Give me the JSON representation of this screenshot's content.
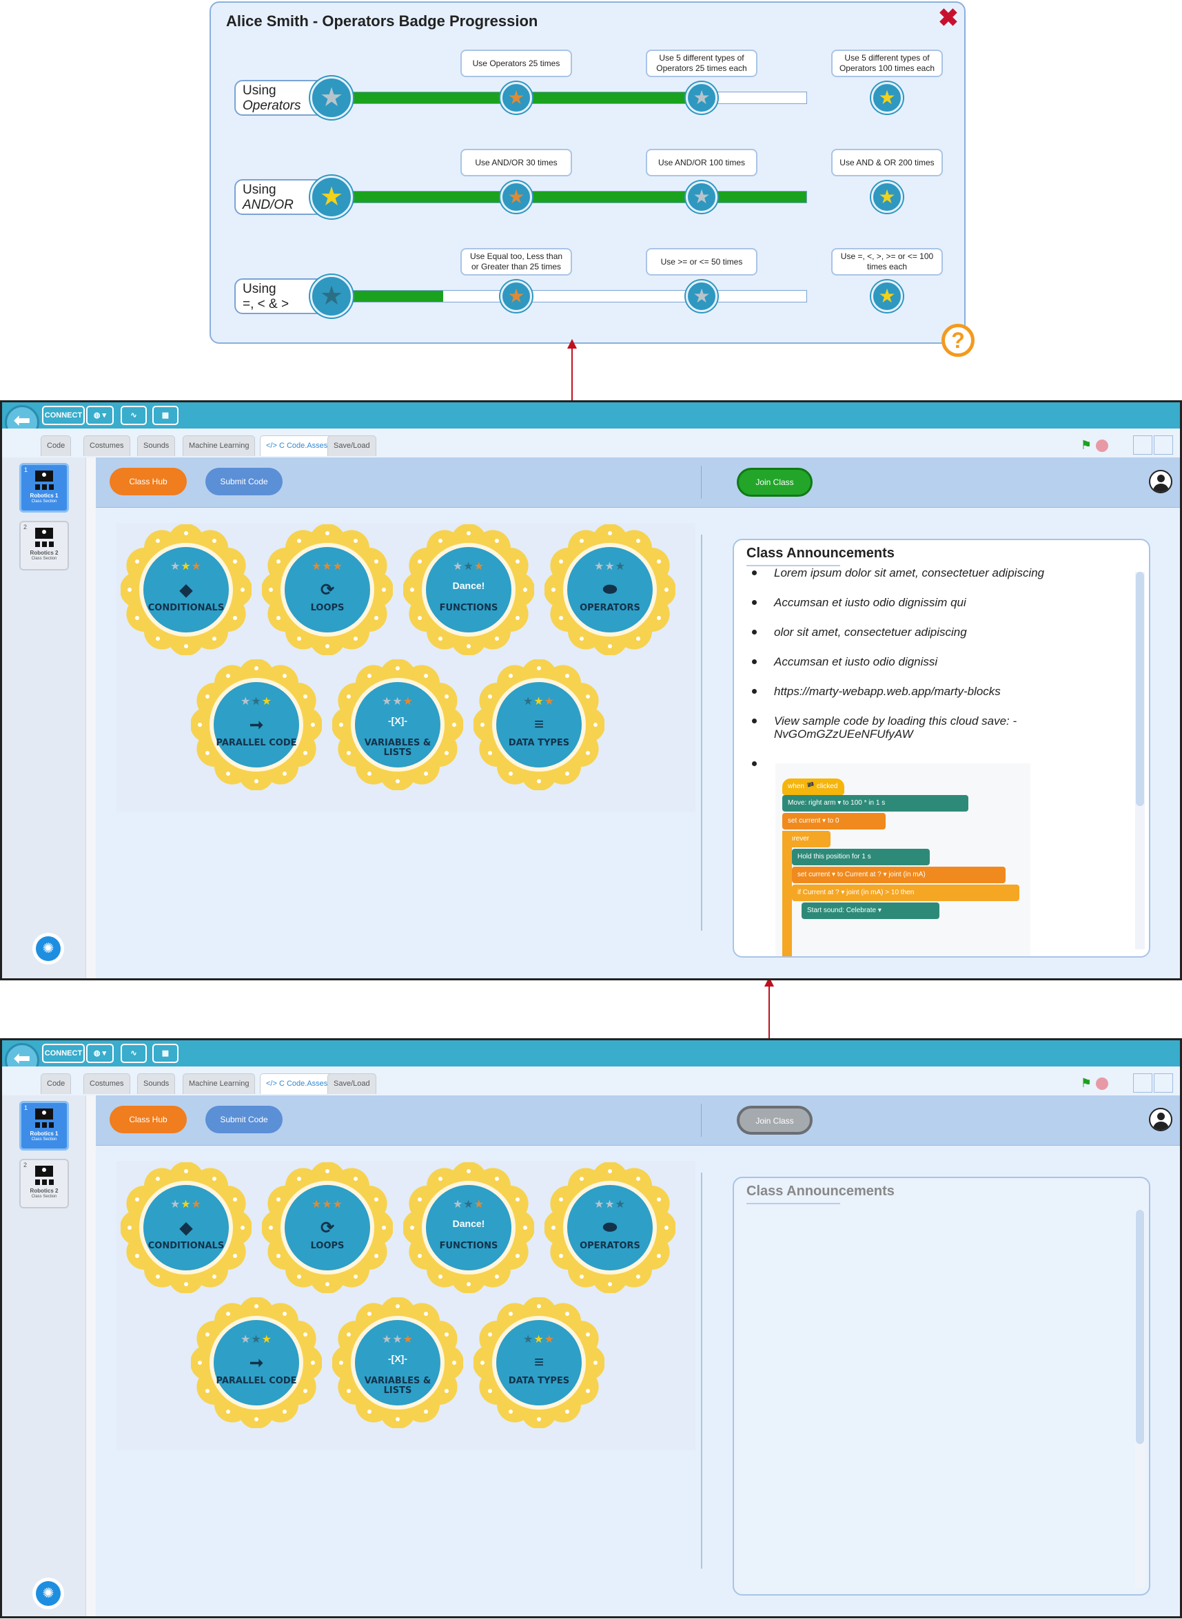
{
  "popup": {
    "title": "Alice Smith - Operators Badge Progression",
    "close_icon": "close-icon",
    "help_icon": "help-icon",
    "help_glyph": "?",
    "rows": [
      {
        "label_1": "Using",
        "label_2": "Operators",
        "progress": 0.77,
        "milestones": [
          "Use Operators 25 times",
          "Use 5 different types of Operators 25 times each",
          "Use 5 different types of Operators 100 times each"
        ]
      },
      {
        "label_1": "Using",
        "label_2": "AND/OR",
        "progress": 1.0,
        "milestones": [
          "Use AND/OR 30 times",
          "Use AND/OR 100 times",
          "Use AND & OR 200 times"
        ]
      },
      {
        "label_1": "Using",
        "label_2": "=, < & >",
        "progress": 0.24,
        "milestones": [
          "Use Equal too, Less than or Greater than 25 times",
          "Use >= or <= 50 times",
          "Use =, <, >, >= or <= 100 times each"
        ]
      }
    ]
  },
  "app": {
    "connect_label": "CONNECT",
    "tabs": [
      "Code",
      "Costumes",
      "Sounds",
      "Machine Learning",
      "</> C Code.Asses",
      "Save/Load"
    ],
    "hub_label": "Class Hub",
    "submit_label": "Submit Code",
    "join_label": "Join Class",
    "classes": [
      {
        "num": "1",
        "name": "Robotics 1",
        "sub": "Class Section"
      },
      {
        "num": "2",
        "name": "Robotics 2",
        "sub": "Class Section"
      }
    ],
    "badges": [
      {
        "title": "CONDITIONALS",
        "glyph": "◆",
        "stars": "★★★",
        "star_colors": [
          "#b8c4cc",
          "#f2d21b",
          "#e08a34"
        ]
      },
      {
        "title": "LOOPS",
        "glyph": "⟳",
        "stars": "★★★",
        "star_colors": [
          "#e08a34",
          "#e08a34",
          "#e08a34"
        ]
      },
      {
        "title": "FUNCTIONS",
        "glyph": "Dance!",
        "stars": "★★★",
        "star_colors": [
          "#b8c4cc",
          "#2b6f86",
          "#e08a34"
        ]
      },
      {
        "title": "OPERATORS",
        "glyph": "⬬",
        "stars": "★★★",
        "star_colors": [
          "#b8c4cc",
          "#b8c4cc",
          "#2b6f86"
        ]
      },
      {
        "title": "PARALLEL CODE",
        "glyph": "➞",
        "stars": "★★★",
        "star_colors": [
          "#b8c4cc",
          "#2b6f86",
          "#f2d21b"
        ]
      },
      {
        "title": "VARIABLES & LISTS",
        "glyph": "-[X]-",
        "stars": "★★★",
        "star_colors": [
          "#b8c4cc",
          "#b8c4cc",
          "#e08a34"
        ]
      },
      {
        "title": "DATA TYPES",
        "glyph": "≡",
        "stars": "★★★",
        "star_colors": [
          "#2b6f86",
          "#f2d21b",
          "#e08a34"
        ]
      }
    ],
    "announcements_title": "Class Announcements",
    "announcements": [
      "Lorem ipsum dolor sit amet, consectetuer adipiscing",
      "Accumsan et iusto odio dignissim qui",
      "olor sit amet, consectetuer adipiscing",
      "Accumsan et iusto odio dignissi",
      "https://marty-webapp.web.app/marty-blocks",
      "View sample code by loading this cloud save: -NvGOmGZzUEeNFUfyAW"
    ],
    "code_blocks": {
      "hat": "when 🏴 clicked",
      "move": "Move: right arm ▾ to 100 * in 1 s",
      "set1": "set current ▾ to 0",
      "forever": "forever",
      "hold": "Hold this position for 1 s",
      "set2": "set current ▾ to Current at ? ▾ joint (in mA)",
      "if": "if Current at ? ▾ joint (in mA) > 10 then",
      "sound": "Start sound: Celebrate ▾"
    }
  },
  "colors": {
    "accent": "#3aaccc",
    "progress_fill": "#1aa21e",
    "join_green": "#23a52a",
    "join_gray": "#a5aaaf"
  }
}
